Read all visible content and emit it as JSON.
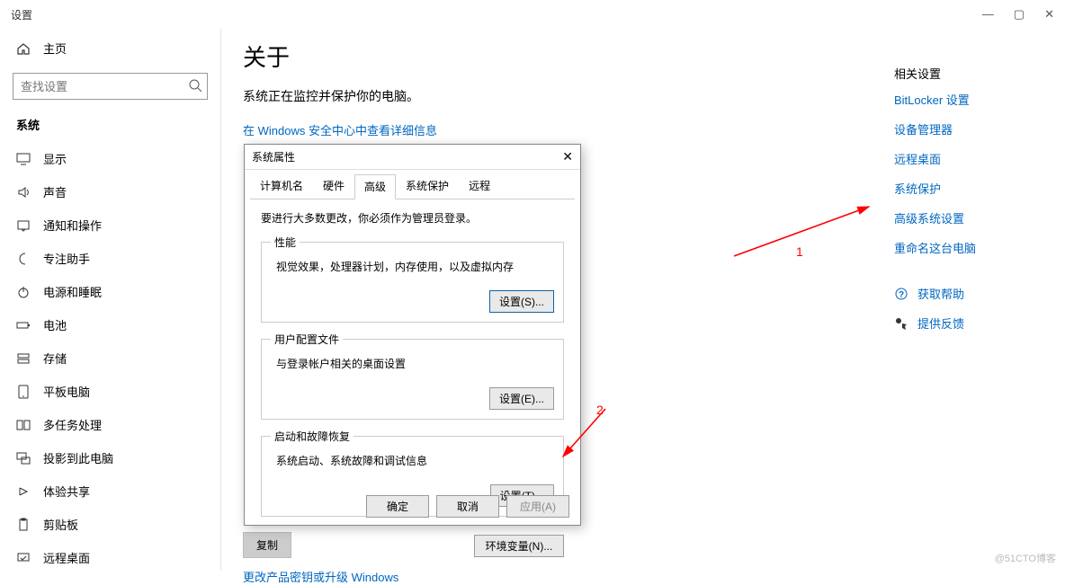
{
  "window": {
    "title": "设置",
    "min": "—",
    "max": "▢",
    "close": "✕"
  },
  "sidebar": {
    "home": "主页",
    "search_placeholder": "查找设置",
    "group": "系统",
    "items": [
      {
        "label": "显示"
      },
      {
        "label": "声音"
      },
      {
        "label": "通知和操作"
      },
      {
        "label": "专注助手"
      },
      {
        "label": "电源和睡眠"
      },
      {
        "label": "电池"
      },
      {
        "label": "存储"
      },
      {
        "label": "平板电脑"
      },
      {
        "label": "多任务处理"
      },
      {
        "label": "投影到此电脑"
      },
      {
        "label": "体验共享"
      },
      {
        "label": "剪贴板"
      },
      {
        "label": "远程桌面"
      }
    ]
  },
  "main": {
    "heading": "关于",
    "status": "系统正在监控并保护你的电脑。",
    "securitylink": "在 Windows 安全中心中查看详细信息",
    "copy_btn": "复制",
    "change_link": "更改产品密钥或升级 Windows"
  },
  "related": {
    "head": "相关设置",
    "links": [
      "BitLocker 设置",
      "设备管理器",
      "远程桌面",
      "系统保护",
      "高级系统设置",
      "重命名这台电脑"
    ],
    "help": "获取帮助",
    "feedback": "提供反馈"
  },
  "dialog": {
    "title": "系统属性",
    "tabs": [
      "计算机名",
      "硬件",
      "高级",
      "系统保护",
      "远程"
    ],
    "note": "要进行大多数更改，你必须作为管理员登录。",
    "perf": {
      "legend": "性能",
      "desc": "视觉效果，处理器计划，内存使用，以及虚拟内存",
      "btn": "设置(S)..."
    },
    "profile": {
      "legend": "用户配置文件",
      "desc": "与登录帐户相关的桌面设置",
      "btn": "设置(E)..."
    },
    "startup": {
      "legend": "启动和故障恢复",
      "desc": "系统启动、系统故障和调试信息",
      "btn": "设置(T)..."
    },
    "env_btn": "环境变量(N)...",
    "ok": "确定",
    "cancel": "取消",
    "apply": "应用(A)"
  },
  "anno": {
    "one": "1",
    "two": "2"
  },
  "watermark": "@51CTO博客"
}
